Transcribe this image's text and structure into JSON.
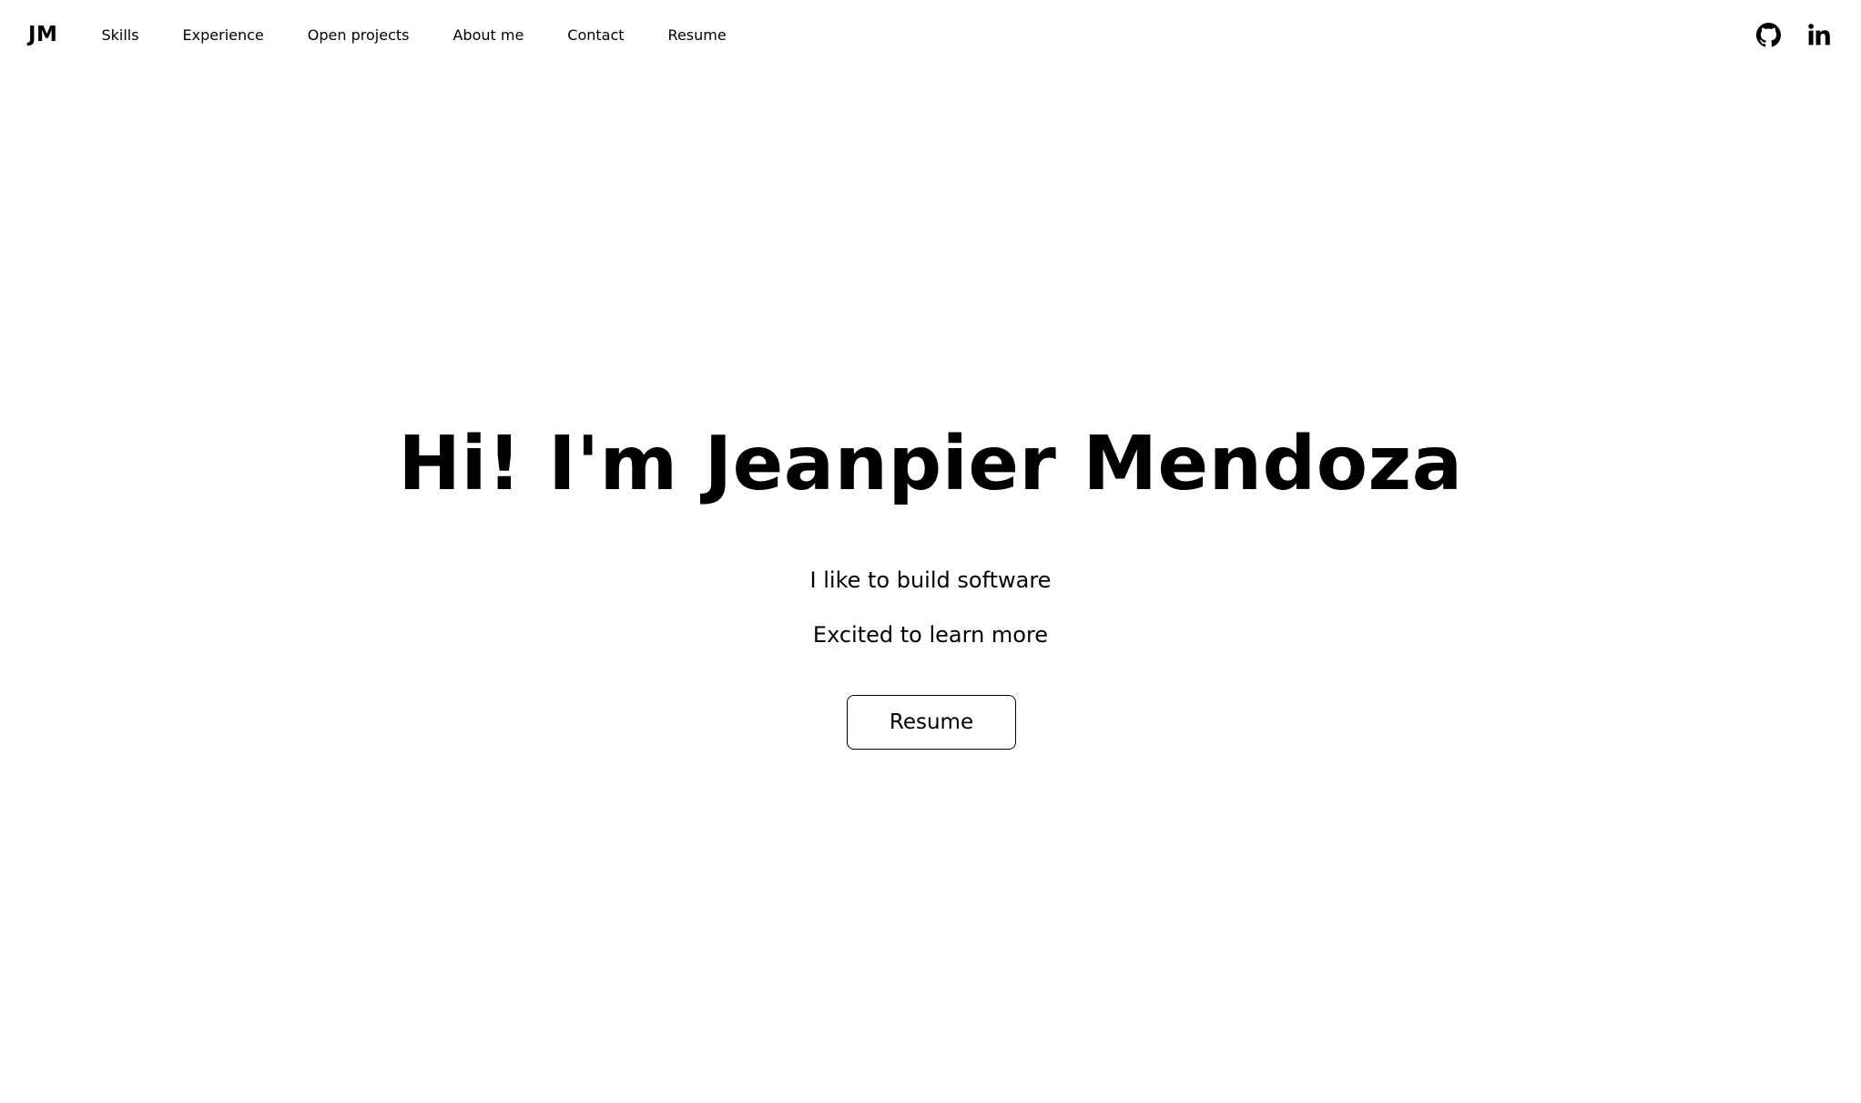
{
  "navbar": {
    "brand": "JM",
    "links": [
      {
        "label": "Skills"
      },
      {
        "label": "Experience"
      },
      {
        "label": "Open projects"
      },
      {
        "label": "About me"
      },
      {
        "label": "Contact"
      },
      {
        "label": "Resume"
      }
    ],
    "social": [
      {
        "icon": "github-icon"
      },
      {
        "icon": "linkedin-icon"
      }
    ]
  },
  "hero": {
    "title": "Hi! I'm Jeanpier Mendoza",
    "lines": [
      "I like to build software",
      "Excited to learn more"
    ],
    "button_label": "Resume"
  },
  "colors": {
    "background": "#ffffff",
    "text": "#000000"
  }
}
